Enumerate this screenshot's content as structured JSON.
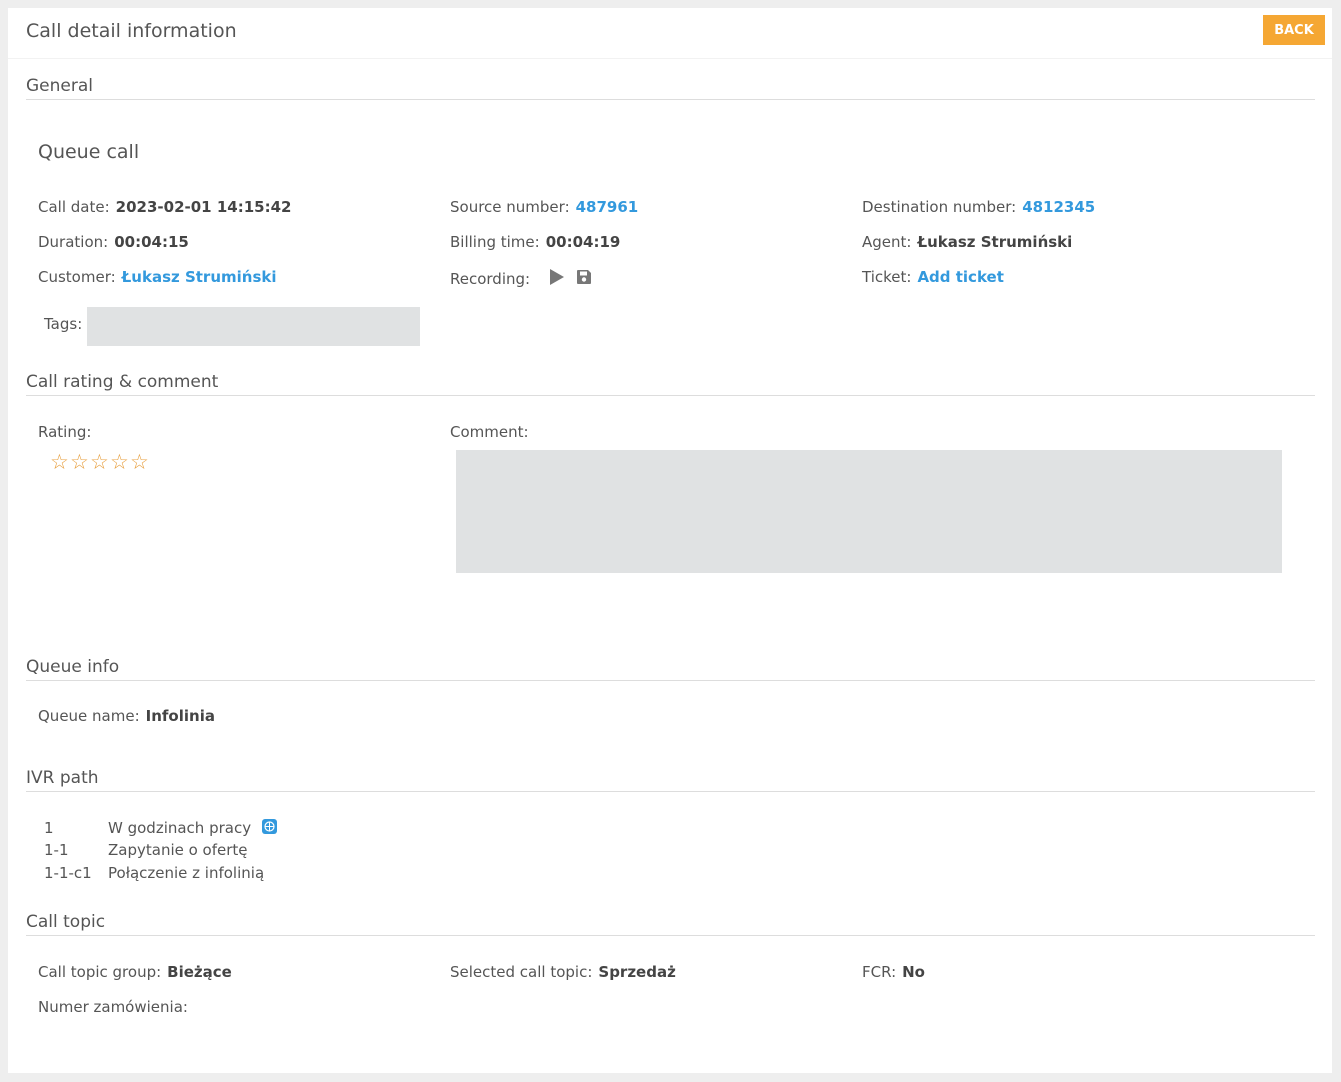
{
  "header": {
    "title": "Call detail information",
    "back_label": "BACK"
  },
  "general": {
    "section_title": "General",
    "subtitle": "Queue call",
    "call_date_label": "Call date:",
    "call_date": "2023-02-01 14:15:42",
    "duration_label": "Duration:",
    "duration": "00:04:15",
    "customer_label": "Customer:",
    "customer": "Łukasz Strumiński",
    "source_label": "Source number:",
    "source": "487961",
    "billing_label": "Billing time:",
    "billing": "00:04:19",
    "recording_label": "Recording:",
    "destination_label": "Destination number:",
    "destination": "4812345",
    "agent_label": "Agent:",
    "agent": "Łukasz Strumiński",
    "ticket_label": "Ticket:",
    "ticket": "Add ticket",
    "tags_label": "Tags:"
  },
  "rating": {
    "section_title": "Call rating & comment",
    "rating_label": "Rating:",
    "stars_filled": 0,
    "stars_total": 5,
    "comment_label": "Comment:"
  },
  "queue": {
    "section_title": "Queue info",
    "name_label": "Queue name:",
    "name": "Infolinia"
  },
  "ivr": {
    "section_title": "IVR path",
    "rows": [
      {
        "num": "1",
        "text": "W godzinach pracy"
      },
      {
        "num": "1-1",
        "text": "Zapytanie o ofertę"
      },
      {
        "num": "1-1-c1",
        "text": "Połączenie z infolinią"
      }
    ]
  },
  "topic": {
    "section_title": "Call topic",
    "group_label": "Call topic group:",
    "group": "Bieżące",
    "selected_label": "Selected call topic:",
    "selected": "Sprzedaż",
    "fcr_label": "FCR:",
    "fcr": "No",
    "order_label": "Numer zamówienia:"
  },
  "colors": {
    "accent": "#f5a733",
    "link": "#3399dd",
    "star": "#e8a040",
    "box": "#e0e2e3"
  },
  "icons": {
    "play": "play-icon",
    "save": "save-icon",
    "star": "star-outline-icon",
    "globe": "globe-icon"
  }
}
